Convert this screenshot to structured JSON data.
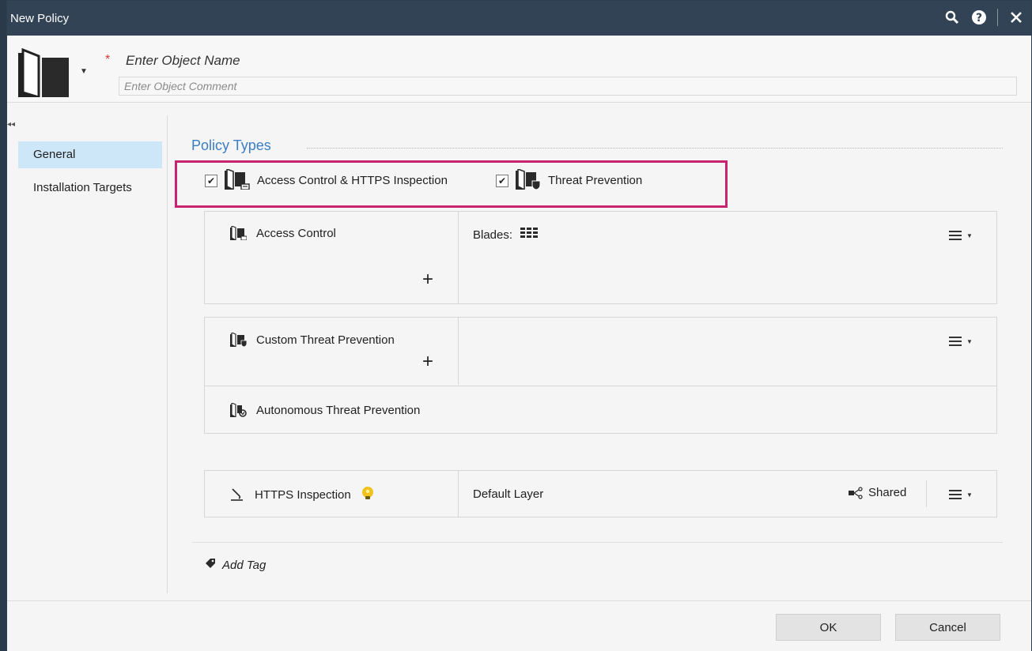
{
  "window": {
    "title": "New Policy"
  },
  "titlebar_icons": [
    "search-icon",
    "help-icon",
    "close-icon"
  ],
  "header": {
    "name_placeholder": "Enter Object Name",
    "comment_placeholder": "Enter Object Comment"
  },
  "sidebar": {
    "items": [
      {
        "label": "General",
        "active": true
      },
      {
        "label": "Installation Targets",
        "active": false
      }
    ]
  },
  "policy_types": {
    "title": "Policy Types",
    "options": [
      {
        "label": "Access Control & HTTPS Inspection",
        "checked": true
      },
      {
        "label": "Threat Prevention",
        "checked": true
      }
    ]
  },
  "access_panel": {
    "label": "Access Control",
    "blades_label": "Blades:"
  },
  "threat_panel": {
    "custom_label": "Custom Threat Prevention",
    "autonomous_label": "Autonomous Threat Prevention"
  },
  "https_panel": {
    "label": "HTTPS Inspection",
    "layer": "Default Layer",
    "shared_label": "Shared"
  },
  "add_tag": "Add Tag",
  "footer": {
    "ok": "OK",
    "cancel": "Cancel"
  },
  "colors": {
    "accent": "#3b7dc6",
    "highlight": "#c7236f",
    "titlebar": "#324356",
    "active_nav": "#cde6f8"
  }
}
